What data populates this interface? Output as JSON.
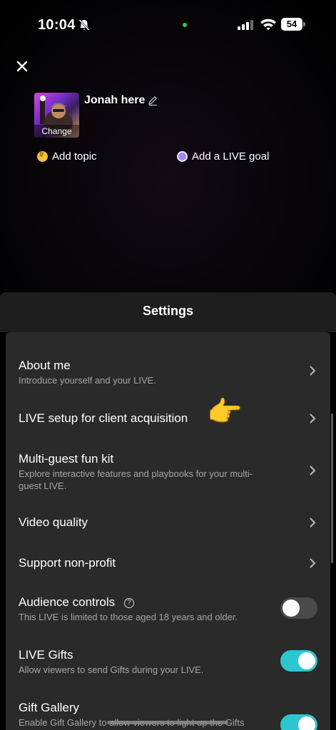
{
  "status_bar": {
    "time": "10:04",
    "battery": "54"
  },
  "live_setup": {
    "cover_change_label": "Change",
    "title": "Jonah here",
    "add_topic_label": "Add topic",
    "add_goal_label": "Add a LIVE goal"
  },
  "settings": {
    "title": "Settings",
    "rows": [
      {
        "title": "About me",
        "subtitle": "Introduce yourself and your LIVE.",
        "control": "chevron"
      },
      {
        "title": "LIVE setup for client acquisition",
        "subtitle": "",
        "control": "chevron"
      },
      {
        "title": "Multi-guest fun kit",
        "subtitle": "Explore interactive features and playbooks for your multi-guest LIVE.",
        "control": "chevron"
      },
      {
        "title": "Video quality",
        "subtitle": "",
        "control": "chevron"
      },
      {
        "title": "Support non-profit",
        "subtitle": "",
        "control": "chevron"
      },
      {
        "title": "Audience controls",
        "subtitle": "This LIVE is limited to those aged 18 years and older.",
        "control": "toggle",
        "on": false
      },
      {
        "title": "LIVE Gifts",
        "subtitle": "Allow viewers to send Gifts during your LIVE.",
        "control": "toggle",
        "on": true
      },
      {
        "title": "Gift Gallery",
        "subtitle": "Enable Gift Gallery to allow viewers to light up the Gifts",
        "control": "toggle",
        "on": true
      }
    ],
    "audience_info_glyph": "?",
    "pointer_emoji": "👉"
  },
  "colors": {
    "toggle_on": "#2cc6d1",
    "toggle_off": "#4a4a4a",
    "sheet_bg": "#2a2a2a"
  },
  "icons": [
    "bell-off-icon",
    "signal-icon",
    "wifi-icon",
    "battery-icon",
    "close-icon",
    "edit-icon",
    "hashtag-icon",
    "target-icon",
    "chevron-right-icon",
    "info-icon"
  ]
}
